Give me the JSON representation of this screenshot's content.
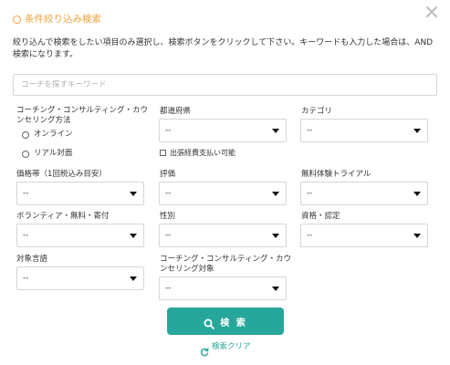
{
  "header": {
    "title": "条件絞り込み検索",
    "accent_color": "#f0a23a",
    "icon": "circle-icon"
  },
  "close": {
    "icon": "close-icon"
  },
  "description": "絞り込んで検索をしたい項目のみ選択し、検索ボタンをクリックして下さい。キーワードも入力した場合は、AND検索になります。",
  "keyword": {
    "placeholder": "コーチを探すキーワード",
    "value": ""
  },
  "coaching_method": {
    "label": "コーチング・コンサルティング・カウンセリング方法",
    "options": [
      "オンライン",
      "リアル対面"
    ]
  },
  "prefecture": {
    "label": "都道府県",
    "value": "--"
  },
  "travel_expense": {
    "label": "出張経費支払い可能"
  },
  "category": {
    "label": "カテゴリ",
    "value": "--"
  },
  "price_range": {
    "label": "価格帯（1回税込み目安）",
    "value": "--"
  },
  "rating": {
    "label": "評価",
    "value": "--"
  },
  "free_trial": {
    "label": "無料体験トライアル",
    "value": "--"
  },
  "volunteer": {
    "label": "ボランティア・無料・寄付",
    "value": "--"
  },
  "gender": {
    "label": "性別",
    "value": "--"
  },
  "qualification": {
    "label": "資格・認定",
    "value": "--"
  },
  "language": {
    "label": "対象言語",
    "value": "--"
  },
  "target": {
    "label": "コーチング・コンサルティング・カウンセリング対象",
    "value": "--"
  },
  "search_button": {
    "label": "検 索",
    "icon": "search-icon",
    "color": "#27a79b"
  },
  "clear_link": {
    "label": "検索クリア",
    "icon": "refresh-icon"
  }
}
